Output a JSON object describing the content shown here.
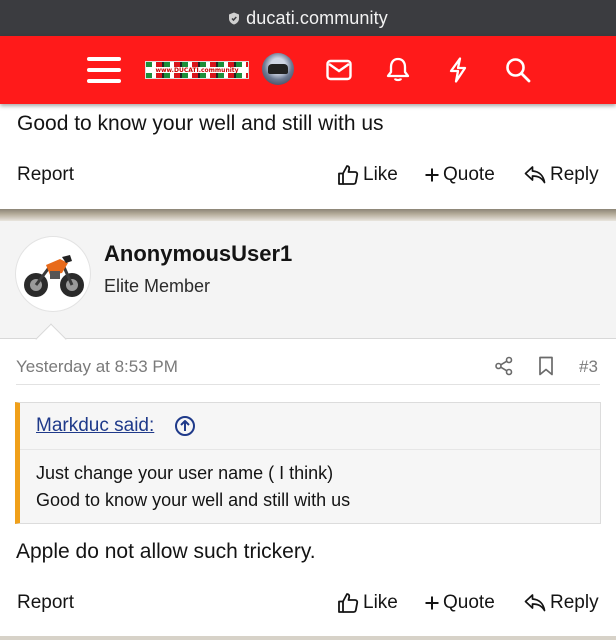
{
  "browser": {
    "url": "ducati.community"
  },
  "header": {
    "logo_text": "www.DUCATI.community",
    "icons": [
      "menu-icon",
      "logo",
      "avatar",
      "mail-icon",
      "bell-icon",
      "bolt-icon",
      "search-icon"
    ],
    "color": "#ff1a1a"
  },
  "previous_post": {
    "text": "Good to know your well and still with us",
    "actions": {
      "report": "Report",
      "like": "Like",
      "quote": "Quote",
      "reply": "Reply"
    }
  },
  "post": {
    "username": "AnonymousUser1",
    "user_title": "Elite Member",
    "date": "Yesterday at 8:53 PM",
    "number": "#3",
    "quote": {
      "author": "Markduc said:",
      "lines": [
        "Just change your user name ( I think)",
        "Good to know your well and still with us"
      ],
      "accent": "#f0a01a"
    },
    "message": "Apple do not allow such trickery.",
    "actions": {
      "report": "Report",
      "like": "Like",
      "quote": "Quote",
      "reply": "Reply"
    }
  }
}
